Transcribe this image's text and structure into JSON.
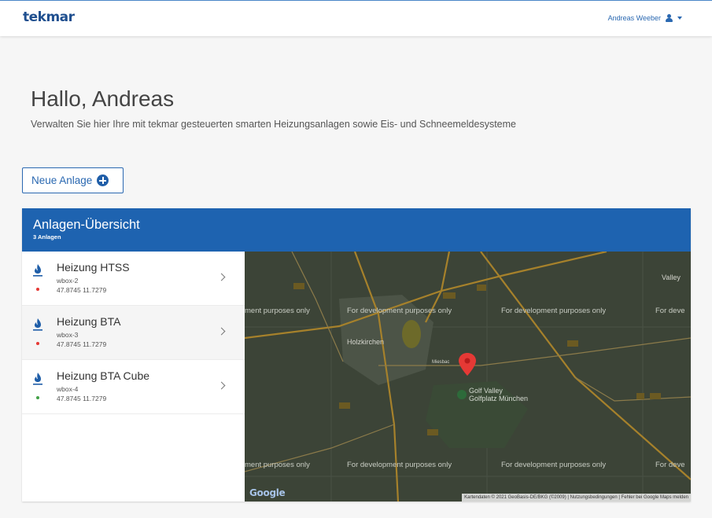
{
  "header": {
    "logo": "tekmar",
    "user_name": "Andreas Weeber"
  },
  "main": {
    "greeting": "Hallo, Andreas",
    "subtitle": "Verwalten Sie hier Ihre mit tekmar gesteuerten smarten Heizungsanlagen sowie Eis- und Schneemeldesysteme",
    "new_button_label": "Neue Anlage"
  },
  "overview": {
    "title": "Anlagen-Übersicht",
    "count": "3 Anlagen",
    "items": [
      {
        "name": "Heizung HTSS",
        "device": "wbox-2",
        "coords": "47.8745 11.7279",
        "status_color": "#e53935"
      },
      {
        "name": "Heizung BTA",
        "device": "wbox-3",
        "coords": "47.8745 11.7279",
        "status_color": "#e53935"
      },
      {
        "name": "Heizung BTA Cube",
        "device": "wbox-4",
        "coords": "47.8745 11.7279",
        "status_color": "#43a047"
      }
    ]
  },
  "map": {
    "watermark": "For development purposes only",
    "watermark_clipped_left": "ment purposes only",
    "watermark_clipped_right": "For deve",
    "place_holzkirchen": "Holzkirchen",
    "place_valley": "Valley",
    "poi_line1": "Golf Valley",
    "poi_line2": "Golfplatz München",
    "road_label": "Miesbac",
    "google_logo": "Google",
    "attribution_data": "Kartendaten © 2021 GeoBasis-DE/BKG (©2009)",
    "attribution_terms": "Nutzungsbedingungen",
    "attribution_report": "Fehler bei Google Maps melden",
    "marker_color": "#e53935",
    "road_color": "#a6812b"
  },
  "colors": {
    "brand": "#1f4f8f",
    "accent": "#1e63b0",
    "status_red": "#e53935",
    "status_green": "#43a047"
  }
}
